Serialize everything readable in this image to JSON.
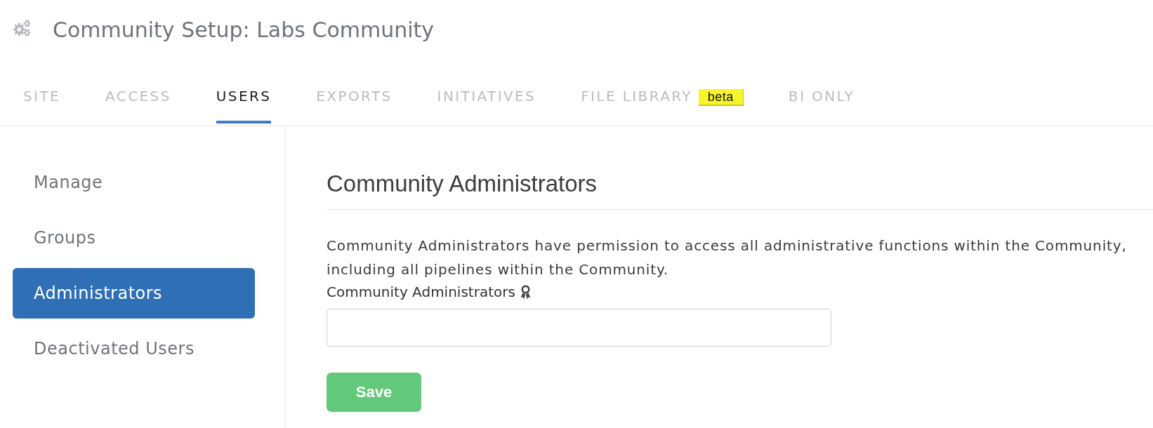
{
  "header": {
    "title": "Community Setup: Labs Community"
  },
  "tabs": [
    {
      "label": "SITE",
      "selected": false
    },
    {
      "label": "ACCESS",
      "selected": false
    },
    {
      "label": "USERS",
      "selected": true
    },
    {
      "label": "EXPORTS",
      "selected": false
    },
    {
      "label": "INITIATIVES",
      "selected": false
    },
    {
      "label": "FILE LIBRARY",
      "selected": false,
      "badge": "beta"
    },
    {
      "label": "BI ONLY",
      "selected": false
    }
  ],
  "sidebar": {
    "items": [
      {
        "label": "Manage",
        "selected": false
      },
      {
        "label": "Groups",
        "selected": false
      },
      {
        "label": "Administrators",
        "selected": true
      },
      {
        "label": "Deactivated Users",
        "selected": false
      }
    ]
  },
  "section": {
    "heading": "Community Administrators",
    "description": "Community Administrators have permission to access all administrative functions within the Community, including all pipelines within the Community.",
    "field": {
      "label": "Community Administrators"
    },
    "buttons": [
      {
        "label": "Save",
        "kind": "primary"
      }
    ]
  }
}
